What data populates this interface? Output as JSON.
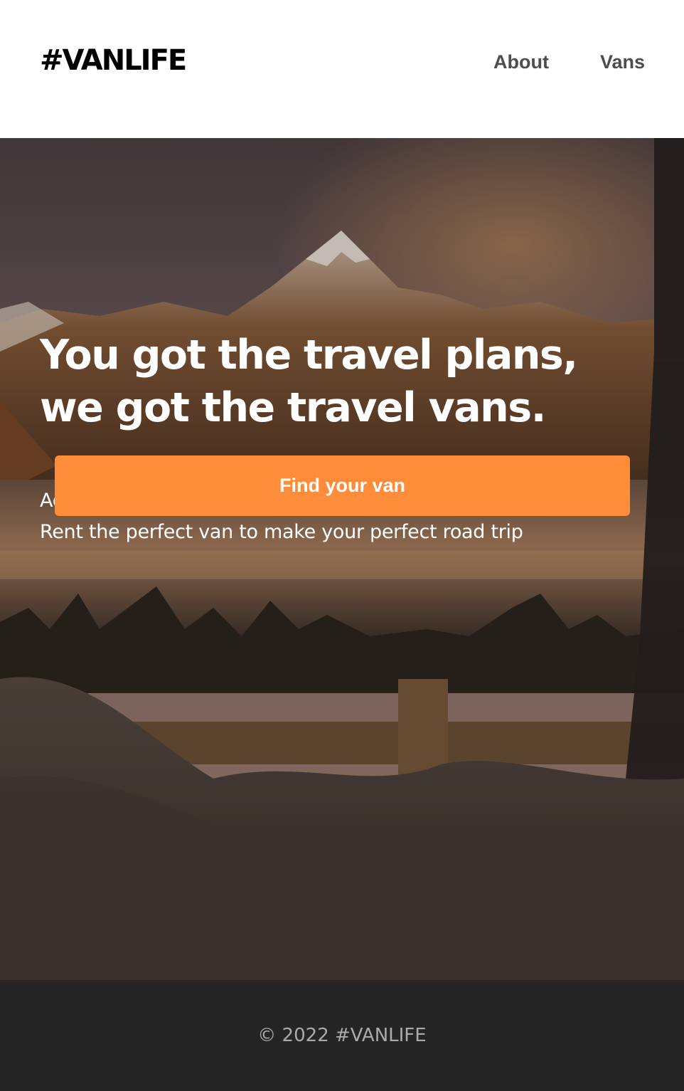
{
  "header": {
    "logo": "#VANLIFE",
    "nav": [
      {
        "label": "About"
      },
      {
        "label": "Vans"
      }
    ]
  },
  "hero": {
    "title": "You got the travel plans, we got the travel vans.",
    "subtitle": "Add adventure to your life by joining the #vanlife movement. Rent the perfect van to make your perfect road trip",
    "cta_label": "Find your van",
    "background_description_icon": "mountain-lake-van-photo"
  },
  "footer": {
    "copyright": "© 2022 #VANLIFE"
  },
  "colors": {
    "accent": "#ff8c38",
    "footer_bg": "#252525",
    "nav_text": "#4d4d4d"
  }
}
